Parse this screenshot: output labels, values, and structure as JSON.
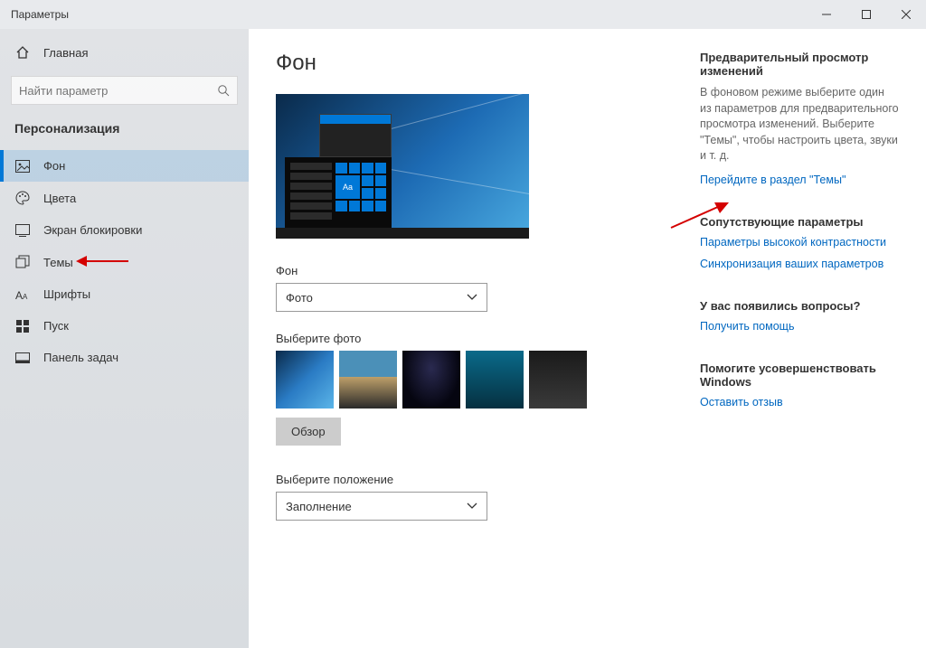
{
  "window": {
    "title": "Параметры"
  },
  "sidebar": {
    "home": "Главная",
    "search_placeholder": "Найти параметр",
    "section": "Персонализация",
    "items": [
      {
        "label": "Фон"
      },
      {
        "label": "Цвета"
      },
      {
        "label": "Экран блокировки"
      },
      {
        "label": "Темы"
      },
      {
        "label": "Шрифты"
      },
      {
        "label": "Пуск"
      },
      {
        "label": "Панель задач"
      }
    ]
  },
  "content": {
    "heading": "Фон",
    "preview_tile_text": "Aa",
    "bg_label": "Фон",
    "bg_select": "Фото",
    "choose_label": "Выберите фото",
    "browse": "Обзор",
    "fit_label": "Выберите положение",
    "fit_select": "Заполнение"
  },
  "rightcol": {
    "preview_heading": "Предварительный просмотр изменений",
    "preview_text": "В фоновом режиме выберите один из параметров для предварительного просмотра изменений. Выберите \"Темы\", чтобы настроить цвета, звуки и т. д.",
    "themes_link": "Перейдите в раздел \"Темы\"",
    "related_heading": "Сопутствующие параметры",
    "hc_link": "Параметры высокой контрастности",
    "sync_link": "Синхронизация ваших параметров",
    "questions_heading": "У вас появились вопросы?",
    "help_link": "Получить помощь",
    "feedback_heading": "Помогите усовершенствовать Windows",
    "feedback_link": "Оставить отзыв"
  }
}
